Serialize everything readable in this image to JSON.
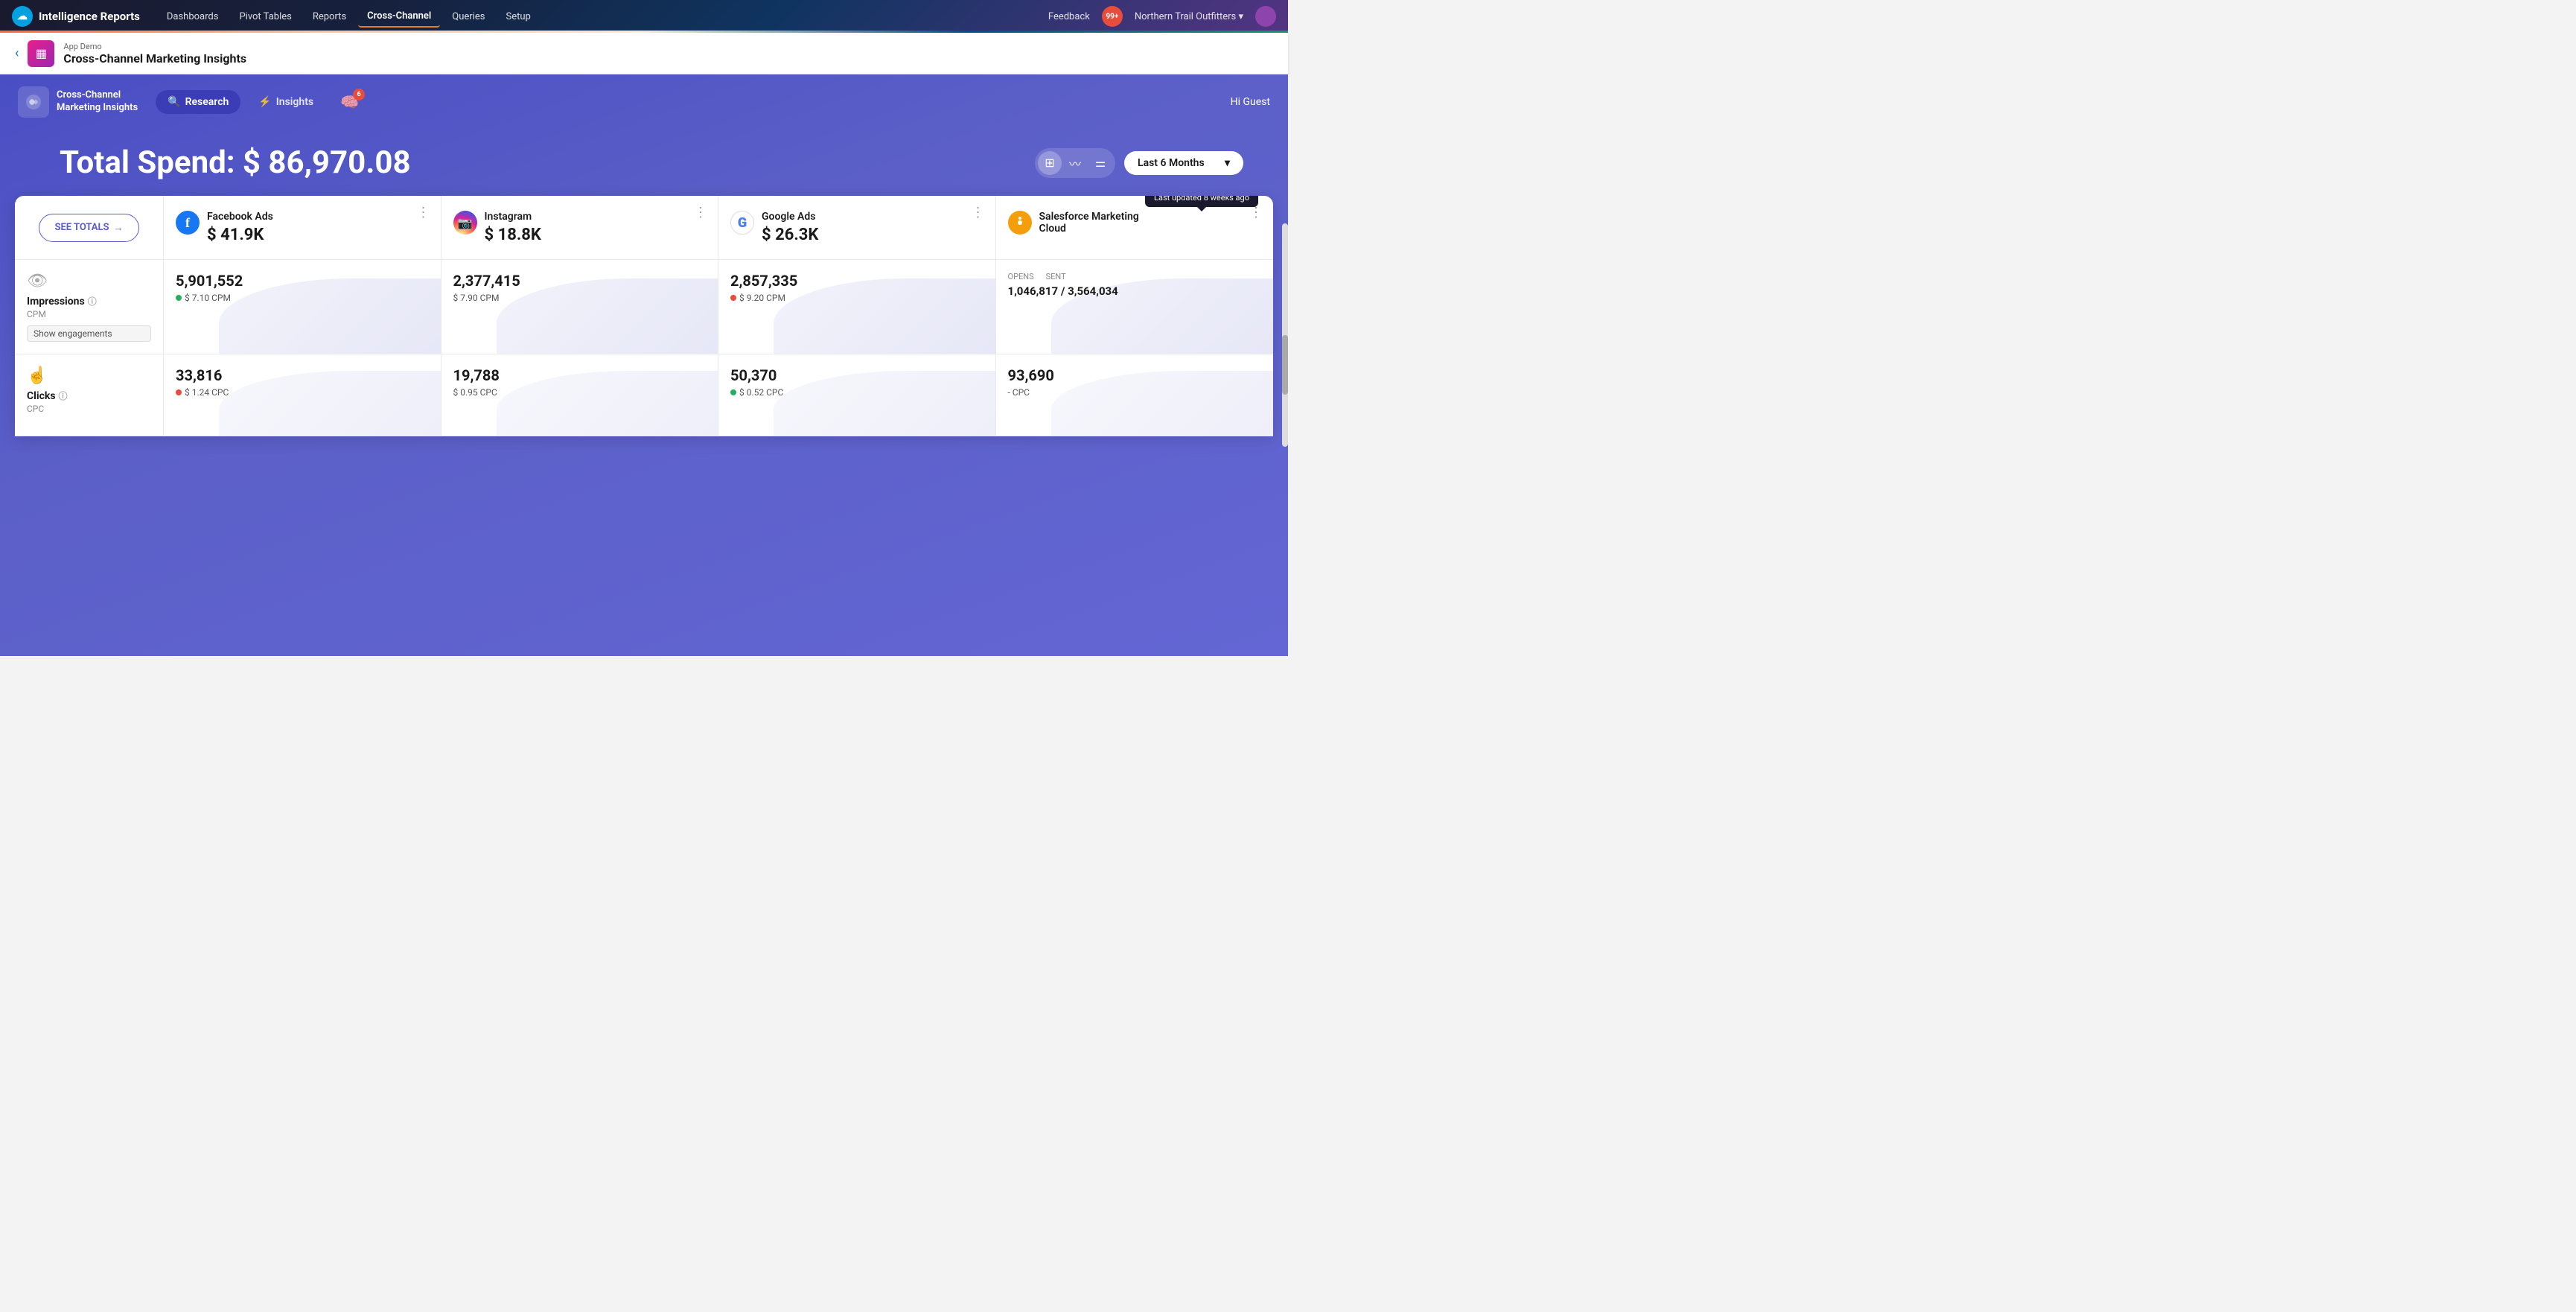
{
  "app": {
    "name": "Intelligence Reports",
    "logo_unicode": "☁"
  },
  "nav": {
    "items": [
      {
        "label": "Dashboards",
        "active": false
      },
      {
        "label": "Pivot Tables",
        "active": false
      },
      {
        "label": "Reports",
        "active": false
      },
      {
        "label": "Cross-Channel",
        "active": true
      },
      {
        "label": "Queries",
        "active": false
      },
      {
        "label": "Setup",
        "active": false
      }
    ],
    "feedback_label": "Feedback",
    "notification_count": "99+",
    "org_name": "Northern Trail Outfitters",
    "org_chevron": "▾"
  },
  "breadcrumb": {
    "app_label": "App Demo",
    "page_title": "Cross-Channel Marketing Insights",
    "icon_unicode": "▦"
  },
  "inner_nav": {
    "app_logo_line1": "Cross-Channel",
    "app_logo_line2": "Marketing Insights",
    "research_label": "Research",
    "insights_label": "Insights",
    "ai_badge_count": "6",
    "hi_guest": "Hi Guest"
  },
  "spend": {
    "label": "Total Spend:",
    "value": "$ 86,970.08"
  },
  "controls": {
    "date_range": "Last 6 Months",
    "chevron": "▾"
  },
  "table": {
    "see_totals_label": "SEE TOTALS",
    "see_totals_arrow": "→",
    "tooltip_text": "Last updated 8 weeks ago",
    "channels": [
      {
        "name": "Facebook Ads",
        "icon_type": "fb",
        "icon_unicode": "f",
        "spend": "$ 41.9K"
      },
      {
        "name": "Instagram",
        "icon_type": "ig",
        "icon_unicode": "◎",
        "spend": "$ 18.8K"
      },
      {
        "name": "Google Ads",
        "icon_type": "google",
        "icon_unicode": "G",
        "spend": "$ 26.3K"
      },
      {
        "name": "Salesforce Marketing Cloud",
        "icon_type": "sfmc",
        "icon_unicode": "🔍",
        "spend": ""
      }
    ],
    "rows": [
      {
        "metric_name": "Impressions",
        "metric_icon": "👁",
        "metric_sub": "CPM",
        "show_engagements": true,
        "show_engagements_label": "Show engagements",
        "cells": [
          {
            "value": "5,901,552",
            "cpm_label": "$ 7.10 CPM",
            "dot": "green",
            "type": "normal"
          },
          {
            "value": "2,377,415",
            "cpm_label": "$ 7.90 CPM",
            "dot": "none",
            "type": "normal"
          },
          {
            "value": "2,857,335",
            "cpm_label": "$ 9.20 CPM",
            "dot": "red",
            "type": "normal"
          },
          {
            "value": "1,046,817 / 3,564,034",
            "cpm_label": "",
            "dot": "none",
            "type": "sfmc",
            "opens_label": "OPENS",
            "sent_label": "SENT"
          }
        ]
      },
      {
        "metric_name": "Clicks",
        "metric_icon": "👆",
        "metric_sub": "CPC",
        "show_engagements": false,
        "cells": [
          {
            "value": "33,816",
            "cpm_label": "$ 1.24 CPC",
            "dot": "red",
            "type": "normal"
          },
          {
            "value": "19,788",
            "cpm_label": "$ 0.95 CPC",
            "dot": "none",
            "type": "normal"
          },
          {
            "value": "50,370",
            "cpm_label": "$ 0.52 CPC",
            "dot": "green",
            "type": "normal"
          },
          {
            "value": "93,690",
            "cpm_label": "- CPC",
            "dot": "none",
            "type": "normal"
          }
        ]
      }
    ]
  }
}
